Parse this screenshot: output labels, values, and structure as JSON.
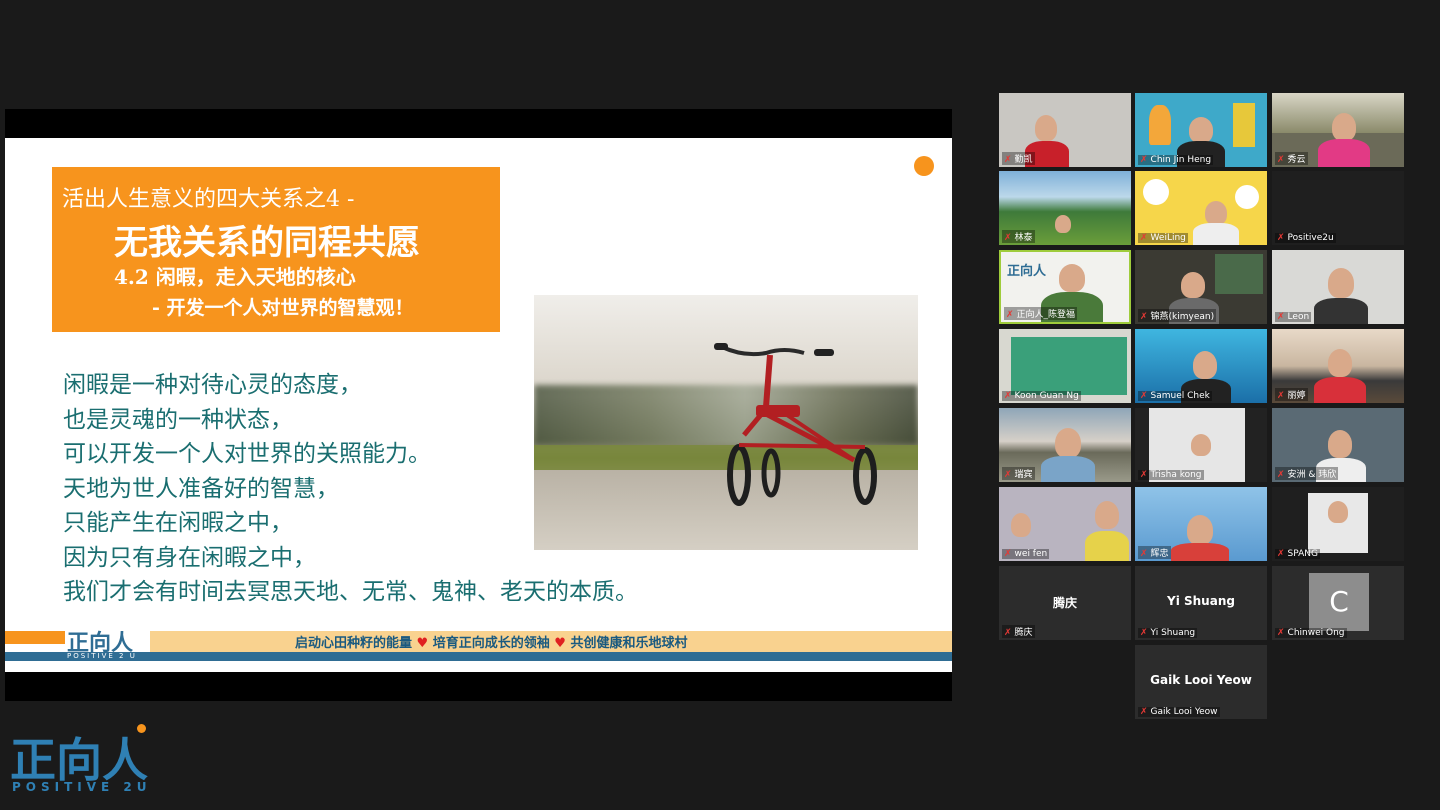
{
  "slide": {
    "title_line1": "活出人生意义的四大关系之4 -",
    "title_line2": "无我关系的同程共愿",
    "title_line3": "4.2 闲暇，走入天地的核心",
    "title_line4": "- 开发一个人对世界的智慧观！",
    "body_lines": [
      "闲暇是一种对待心灵的态度，",
      "也是灵魂的一种状态，",
      "可以开发一个人对世界的关照能力。",
      "天地为世人准备好的智慧，",
      "只能产生在闲暇之中，",
      "因为只有身在闲暇之中，",
      "我们才会有时间去冥思天地、无常、鬼神、老天的本质。"
    ],
    "footer_logo": "正向人",
    "footer_logo_sub": "POSITIVE 2 U",
    "slogan_1": "启动心田种籽的能量",
    "slogan_2": "培育正向成长的领袖",
    "slogan_3": "共创健康和乐地球村",
    "heart": "♥"
  },
  "participants": [
    {
      "name": "勤凯",
      "center_label": ""
    },
    {
      "name": "Chin Jin Heng",
      "center_label": ""
    },
    {
      "name": "秀云",
      "center_label": ""
    },
    {
      "name": "林泰",
      "center_label": ""
    },
    {
      "name": "WeiLing",
      "center_label": ""
    },
    {
      "name": "Positive2u",
      "center_label": ""
    },
    {
      "name": "正向人_陈登福",
      "center_label": "正向人"
    },
    {
      "name": "锦燕(kimyean)",
      "center_label": ""
    },
    {
      "name": "Leon",
      "center_label": ""
    },
    {
      "name": "Koon Guan Ng",
      "center_label": ""
    },
    {
      "name": "Samuel Chek",
      "center_label": ""
    },
    {
      "name": "丽婷",
      "center_label": ""
    },
    {
      "name": "瑞宾",
      "center_label": ""
    },
    {
      "name": "Trisha kong",
      "center_label": ""
    },
    {
      "name": "安洲 & 玮欣",
      "center_label": ""
    },
    {
      "name": "wei fen",
      "center_label": ""
    },
    {
      "name": "辉忠",
      "center_label": ""
    },
    {
      "name": "SPANG",
      "center_label": ""
    },
    {
      "name": "腾庆",
      "center_label": "腾庆"
    },
    {
      "name": "Yi Shuang",
      "center_label": "Yi Shuang"
    },
    {
      "name": "Chinwei Ong",
      "center_label": ""
    },
    {
      "name": "Gaik Looi Yeow",
      "center_label": "Gaik Looi Yeow"
    }
  ],
  "avatar_letter": "C",
  "mic_icon": "✗",
  "brand": {
    "logo": "正向人",
    "sub": "POSITIVE 2U",
    "accent": "#f7941d",
    "blue": "#2f80b4"
  }
}
